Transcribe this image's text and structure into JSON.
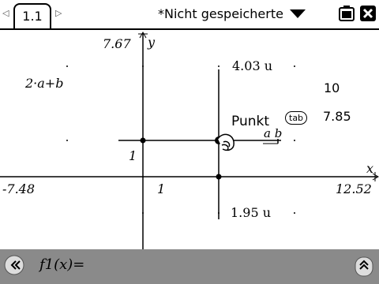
{
  "tab": {
    "label": "1.1"
  },
  "document": {
    "title": "*Nicht gespeicherte"
  },
  "graph": {
    "x_min": "-7.48",
    "x_max": "12.52",
    "y_max": "7.67",
    "x_axis_label": "x",
    "y_axis_label": "y",
    "x_tick_label": "1",
    "y_tick_label": "1"
  },
  "labels": {
    "expression": "2·a+b",
    "length_top": "4.03 u",
    "length_bottom": "1.95 u",
    "value_ten": "10",
    "value_785": "7.85",
    "point_label": "Punkt",
    "tab_key": "tab",
    "segment_label": "a b"
  },
  "entry_line": {
    "label": "f1(x)="
  }
}
